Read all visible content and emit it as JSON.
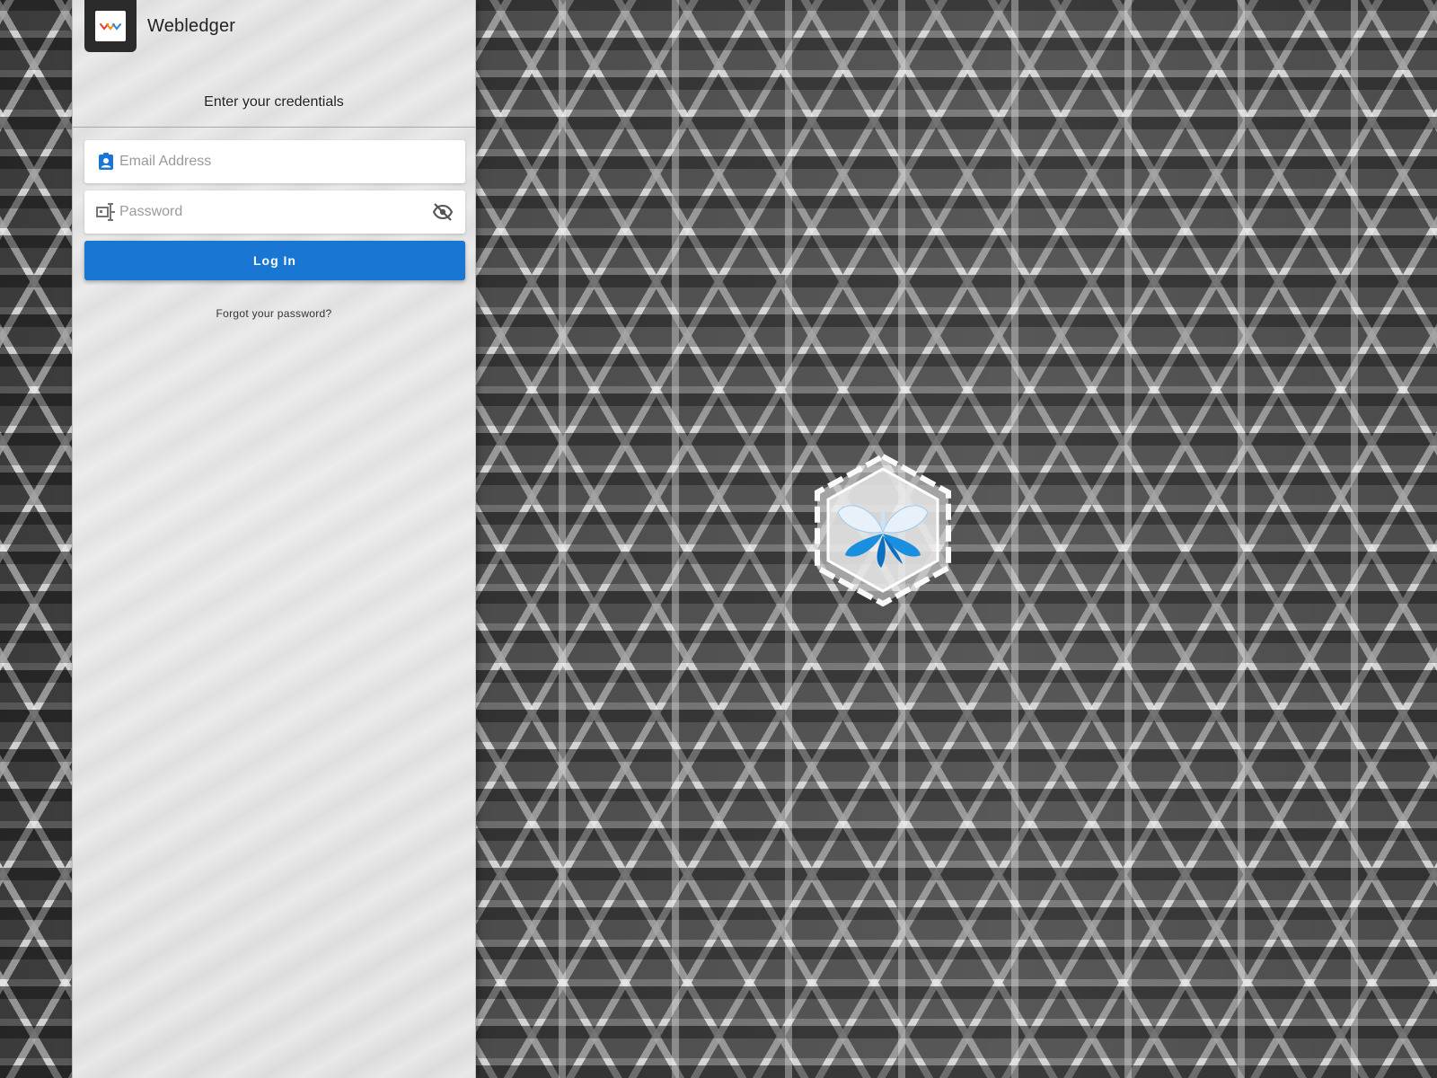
{
  "app": {
    "name": "Webledger"
  },
  "login": {
    "title": "Enter your credentials",
    "email_placeholder": "Email Address",
    "password_placeholder": "Password",
    "login_label": "Log In",
    "forgot_label": "Forgot your password?"
  },
  "icons": {
    "logo": "webledger-logo",
    "email": "contact-badge-icon",
    "password": "password-icon",
    "visibility": "eye-off-icon",
    "emblem": "butterfly-emblem"
  },
  "colors": {
    "primary": "#1976d2",
    "panel_bg": "#e0e0e0",
    "email_icon": "#1976d2",
    "password_icon": "#757575"
  }
}
